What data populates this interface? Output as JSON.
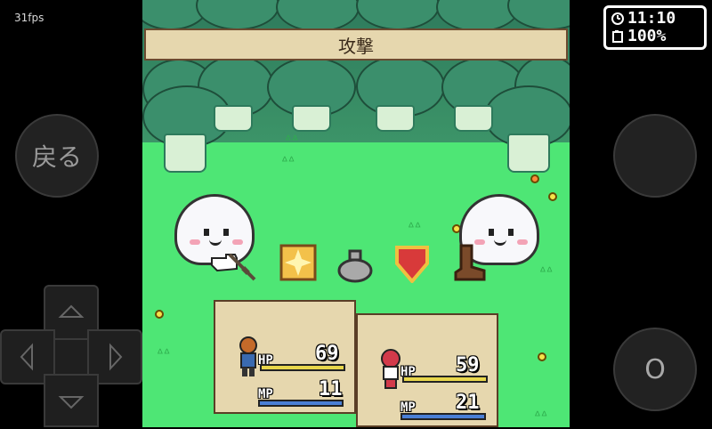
{
  "overlay": {
    "fps": "31fps",
    "back_label": "戻る",
    "ok_label": "O",
    "clock": {
      "time": "11:10",
      "battery": "100%"
    }
  },
  "game": {
    "command_title": "攻撃",
    "commands": [
      {
        "name": "attack",
        "icon": "sword-icon"
      },
      {
        "name": "magic",
        "icon": "spark-icon"
      },
      {
        "name": "item",
        "icon": "bag-icon"
      },
      {
        "name": "defend",
        "icon": "shield-icon"
      },
      {
        "name": "escape",
        "icon": "boot-icon"
      }
    ],
    "party": [
      {
        "name": "hero",
        "hp_label": "HP",
        "hp": "69",
        "mp_label": "MP",
        "mp": "11"
      },
      {
        "name": "girl",
        "hp_label": "HP",
        "hp": "59",
        "mp_label": "MP",
        "mp": "21"
      }
    ],
    "colors": {
      "grass": "#4ee675",
      "panel": "#e6d7ae",
      "hp_bar": "#e8d64a",
      "mp_bar": "#4a7fd6",
      "enemy_body": "#f8f8fb"
    }
  }
}
